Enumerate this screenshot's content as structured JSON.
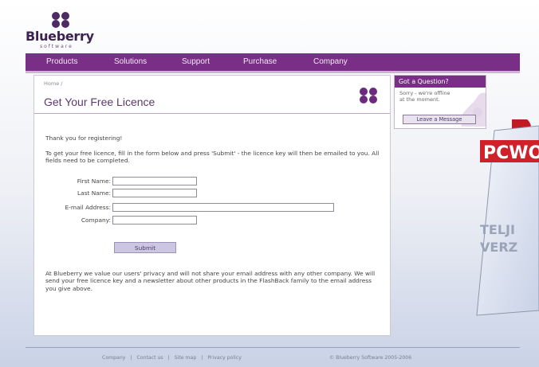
{
  "logo": {
    "name": "Blueberry",
    "tagline": "software"
  },
  "nav": {
    "items": [
      "Products",
      "Solutions",
      "Support",
      "Purchase",
      "Company"
    ]
  },
  "content": {
    "breadcrumb": "Home /",
    "title": "Get Your Free Licence",
    "thanks": "Thank you for registering!",
    "instructions": "To get your free licence, fill in the form below and press 'Submit' - the licence key will then be emailed to you. All fields need to be completed.",
    "form": {
      "first_name_label": "First Name:",
      "last_name_label": "Last Name:",
      "email_label": "E-mail Address:",
      "company_label": "Company:",
      "first_name_value": "",
      "last_name_value": "",
      "email_value": "",
      "company_value": "",
      "submit_label": "Submit"
    },
    "privacy": "At Blueberry we value our users' privacy and will not share your email address with any other company. We will send your free licence key and a newsletter about other products in the FlashBack family to the email address you give above."
  },
  "sidebox": {
    "title": "Got a Question?",
    "text": "Sorry - we're offline at the moment.",
    "button": "Leave a Message"
  },
  "footer": {
    "links": [
      "Company",
      "Contact us",
      "Site map",
      "Privacy policy"
    ],
    "separator": "|",
    "copyright": "© Blueberry Software 2005-2006"
  },
  "badge": {
    "brand": "PCWORL",
    "line1": "TELJI",
    "line2": "VERZ"
  },
  "colors": {
    "brand_purple": "#7a2f87",
    "badge_red": "#d0202a"
  }
}
